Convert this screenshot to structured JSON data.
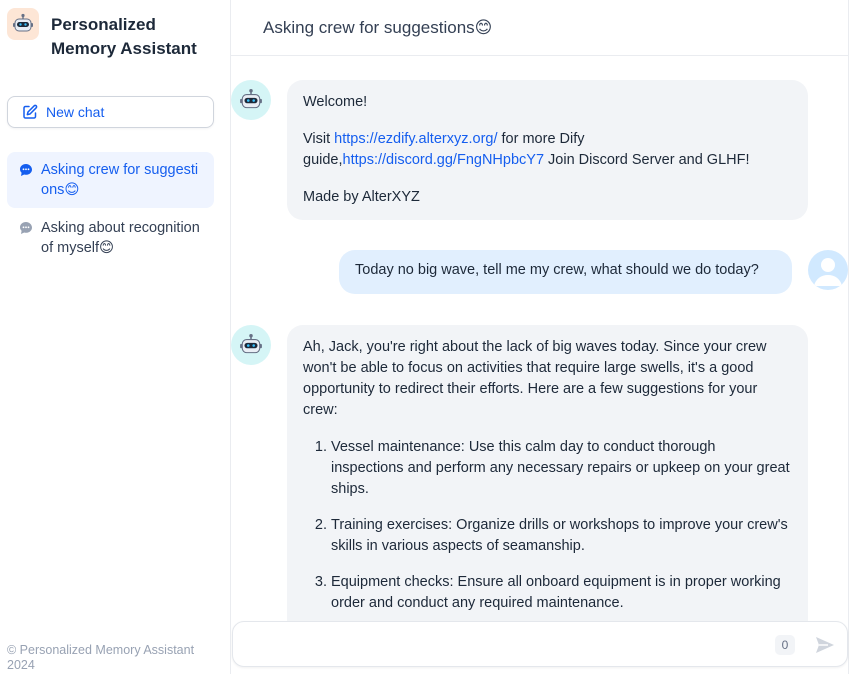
{
  "sidebar": {
    "app_title": "Personalized Memory Assistant",
    "new_chat_label": "New chat",
    "conversations": [
      {
        "label": "Asking crew for suggestions😊",
        "active": true
      },
      {
        "label": "Asking about recognition of myself😊",
        "active": false
      }
    ],
    "footer": "© Personalized Memory Assistant 2024"
  },
  "header": {
    "title": "Asking crew for suggestions😊"
  },
  "messages": {
    "welcome": {
      "line1": "Welcome!",
      "visit_prefix": "Visit ",
      "link1": "https://ezdify.alterxyz.org/",
      "visit_middle": " for more Dify guide,",
      "link2": "https://discord.gg/FngNHpbcY7",
      "visit_suffix": " Join Discord Server and GLHF!",
      "made_by": "Made by AlterXYZ"
    },
    "user": {
      "text": "Today no big wave, tell me my crew, what should we do today?"
    },
    "reply": {
      "intro": "Ah, Jack, you're right about the lack of big waves today. Since your crew won't be able to focus on activities that require large swells, it's a good opportunity to redirect their efforts. Here are a few suggestions for your crew:",
      "items": [
        "Vessel maintenance: Use this calm day to conduct thorough inspections and perform any necessary repairs or upkeep on your great ships.",
        "Training exercises: Organize drills or workshops to improve your crew's skills in various aspects of seamanship.",
        "Equipment checks: Ensure all onboard equipment is in proper working order and conduct any required maintenance."
      ]
    }
  },
  "composer": {
    "placeholder": "",
    "value": "",
    "char_count": "0"
  },
  "icons": {
    "brand": "robot-icon",
    "new_chat": "edit-icon",
    "conversation": "chat-bubble-icon",
    "bot_avatar": "robot-icon",
    "user_avatar": "user-icon",
    "send": "send-icon"
  },
  "colors": {
    "accent": "#155eef",
    "active_bg": "#eff4ff",
    "bot_bubble": "#f2f4f7",
    "user_bubble": "#e1effe"
  }
}
